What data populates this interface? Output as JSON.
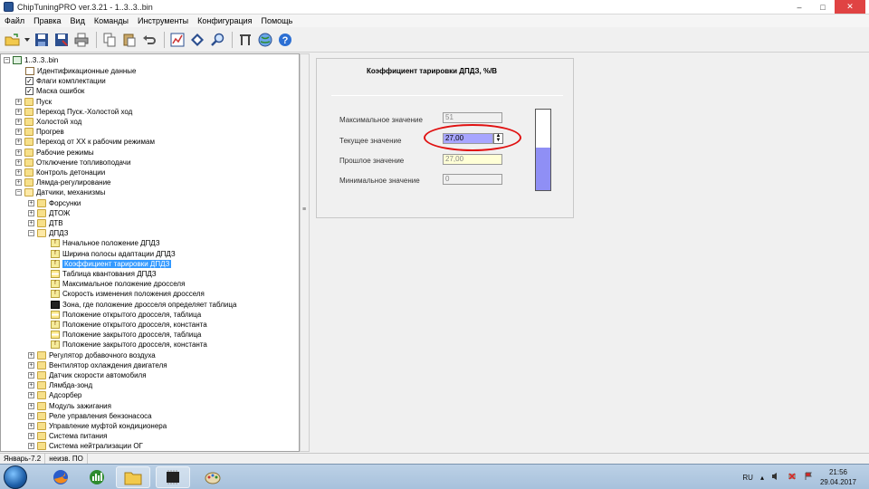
{
  "window": {
    "title": "ChipTuningPRO ver.3.21 - 1..3..3..bin",
    "minimize": "‒",
    "maximize": "□",
    "close": "✕"
  },
  "menu": [
    "Файл",
    "Правка",
    "Вид",
    "Команды",
    "Инструменты",
    "Конфигурация",
    "Помощь"
  ],
  "toolbar": {
    "icons": [
      "open-icon",
      "dropdown-icon",
      "save-icon",
      "save-as-icon",
      "print-icon",
      "copy-icon",
      "paste-icon",
      "undo-icon",
      "chart-icon",
      "compare-icon",
      "search-icon",
      "tools-icon",
      "globe-icon",
      "help-icon"
    ]
  },
  "tree": {
    "root": "1..3..3..bin",
    "items": [
      {
        "label": "Идентификационные данные",
        "level": 1,
        "icon": "doc"
      },
      {
        "label": "Флаги комплектации",
        "level": 1,
        "icon": "check"
      },
      {
        "label": "Маска ошибок",
        "level": 1,
        "icon": "check"
      },
      {
        "label": "Пуск",
        "level": 1,
        "icon": "folder",
        "exp": "+"
      },
      {
        "label": "Переход Пуск.-Холостой ход",
        "level": 1,
        "icon": "folder",
        "exp": "+"
      },
      {
        "label": "Холостой ход",
        "level": 1,
        "icon": "folder",
        "exp": "+"
      },
      {
        "label": "Прогрев",
        "level": 1,
        "icon": "folder",
        "exp": "+"
      },
      {
        "label": "Переход от ХХ к рабочим режимам",
        "level": 1,
        "icon": "folder",
        "exp": "+"
      },
      {
        "label": "Рабочие режимы",
        "level": 1,
        "icon": "folder",
        "exp": "+"
      },
      {
        "label": "Отключение топливоподачи",
        "level": 1,
        "icon": "folder",
        "exp": "+"
      },
      {
        "label": "Контроль детонации",
        "level": 1,
        "icon": "folder",
        "exp": "+"
      },
      {
        "label": "Лямда-регулирование",
        "level": 1,
        "icon": "folder",
        "exp": "+"
      },
      {
        "label": "Датчики, механизмы",
        "level": 1,
        "icon": "folder-open",
        "exp": "−"
      },
      {
        "label": "Форсунки",
        "level": 2,
        "icon": "folder",
        "exp": "+"
      },
      {
        "label": "ДТОЖ",
        "level": 2,
        "icon": "folder",
        "exp": "+"
      },
      {
        "label": "ДТВ",
        "level": 2,
        "icon": "folder",
        "exp": "+"
      },
      {
        "label": "ДПДЗ",
        "level": 2,
        "icon": "folder-open",
        "exp": "−"
      },
      {
        "label": "Начальное положение ДПДЗ",
        "level": 3,
        "icon": "param"
      },
      {
        "label": "Ширина полосы адаптации ДПДЗ",
        "level": 3,
        "icon": "param"
      },
      {
        "label": "Коэффициент тарировки ДПДЗ",
        "level": 3,
        "icon": "param",
        "selected": true
      },
      {
        "label": "Таблица квантования ДПДЗ",
        "level": 3,
        "icon": "table"
      },
      {
        "label": "Максимальное положение дросселя",
        "level": 3,
        "icon": "param"
      },
      {
        "label": "Скорость изменения положения дросселя",
        "level": 3,
        "icon": "param"
      },
      {
        "label": "Зона, где положение дросселя определяет таблица",
        "level": 3,
        "icon": "map"
      },
      {
        "label": "Положение открытого дросселя, таблица",
        "level": 3,
        "icon": "table"
      },
      {
        "label": "Положение открытого дросселя, константа",
        "level": 3,
        "icon": "param"
      },
      {
        "label": "Положение закрытого дросселя, таблица",
        "level": 3,
        "icon": "table"
      },
      {
        "label": "Положение закрытого дросселя, константа",
        "level": 3,
        "icon": "param"
      },
      {
        "label": "Регулятор добавочного воздуха",
        "level": 2,
        "icon": "folder",
        "exp": "+"
      },
      {
        "label": "Вентилятор охлаждения двигателя",
        "level": 2,
        "icon": "folder",
        "exp": "+"
      },
      {
        "label": "Датчик скорости автомобиля",
        "level": 2,
        "icon": "folder",
        "exp": "+"
      },
      {
        "label": "Лямбда-зонд",
        "level": 2,
        "icon": "folder",
        "exp": "+"
      },
      {
        "label": "Адсорбер",
        "level": 2,
        "icon": "folder",
        "exp": "+"
      },
      {
        "label": "Модуль зажигания",
        "level": 2,
        "icon": "folder",
        "exp": "+"
      },
      {
        "label": "Реле управления бензонасоса",
        "level": 2,
        "icon": "folder",
        "exp": "+"
      },
      {
        "label": "Управление муфтой кондиционера",
        "level": 2,
        "icon": "folder",
        "exp": "+"
      },
      {
        "label": "Система питания",
        "level": 2,
        "icon": "folder",
        "exp": "+"
      },
      {
        "label": "Система нейтрализации ОГ",
        "level": 2,
        "icon": "folder",
        "exp": "+"
      }
    ]
  },
  "param": {
    "title": "Коэффициент тарировки ДПДЗ, %/В",
    "max_label": "Максимальное значение",
    "max_value": "51",
    "current_label": "Текущее значение",
    "current_value": "27,00",
    "prev_label": "Прошлое значение",
    "prev_value": "27,00",
    "min_label": "Минимальное значение",
    "min_value": "0",
    "gauge_fraction": 0.53,
    "current_color": "#a7a5ff",
    "highlight_color": "#e01010"
  },
  "status": {
    "left": "Январь-7.2",
    "right": "неизв. ПО"
  },
  "taskbar": {
    "apps": [
      "firefox-icon",
      "finance-icon",
      "explorer-icon",
      "chip-icon",
      "paint-icon"
    ],
    "lang": "RU",
    "time": "21:56",
    "date": "29.04.2017"
  }
}
